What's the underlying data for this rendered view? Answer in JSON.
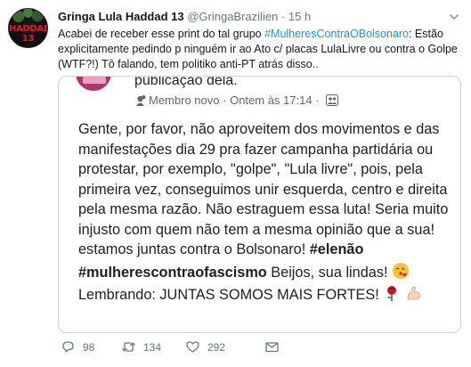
{
  "tweet": {
    "avatar_text": "HADDAD 13",
    "author_name": "Gringa Lula Haddad 13",
    "handle": "@GringaBrazilien",
    "separator": "·",
    "time": "15 h",
    "text_part1": "Acabei de receber esse print do tal grupo ",
    "hashtag": "#MulheresContraOBolsonaro",
    "text_part2": ": Estão explicitamente pedindo p ninguém ir ao Ato c/ placas LulaLivre ou contra o Golpe (WTF?!) Tô falando, tem politiko anti-PT atrás disso..",
    "media": {
      "top_text": "publicação dela.",
      "member_label": "Membro novo",
      "meta_sep": "·",
      "time": "Ontem às 17:14",
      "meta_sep2": "·",
      "para1": "Gente, por favor, não aproveitem dos movimentos e das manifestações dia 29 pra fazer campanha partidária ou protestar, por exemplo, \"golpe\", \"Lula livre\", pois, pela primeira vez,  conseguimos unir esquerda, centro e direita pela mesma razão. Não estraguem essa luta! Seria muito injusto com quem não tem a mesma opinião que a sua! estamos juntas contra o Bolsonaro! ",
      "hashtag1": "#elenão",
      "hashtag2": "#mulherescontraofascismo",
      "para2_rest": " Beijos, sua lindas! ",
      "para3": "Lembrando: JUNTAS SOMOS MAIS FORTES! "
    },
    "actions": {
      "reply_count": "98",
      "retweet_count": "134",
      "like_count": "292"
    }
  },
  "colors": {
    "link": "#1b95e0",
    "muted": "#657786",
    "border": "#ccd6dd",
    "avatar_text": "#e0201e"
  },
  "icons": [
    "chevron-down-icon",
    "member-badge-icon",
    "group-icon",
    "kiss-emoji-icon",
    "rose-emoji-icon",
    "flexed-biceps-emoji-icon",
    "reply-icon",
    "retweet-icon",
    "like-icon",
    "direct-message-icon"
  ]
}
